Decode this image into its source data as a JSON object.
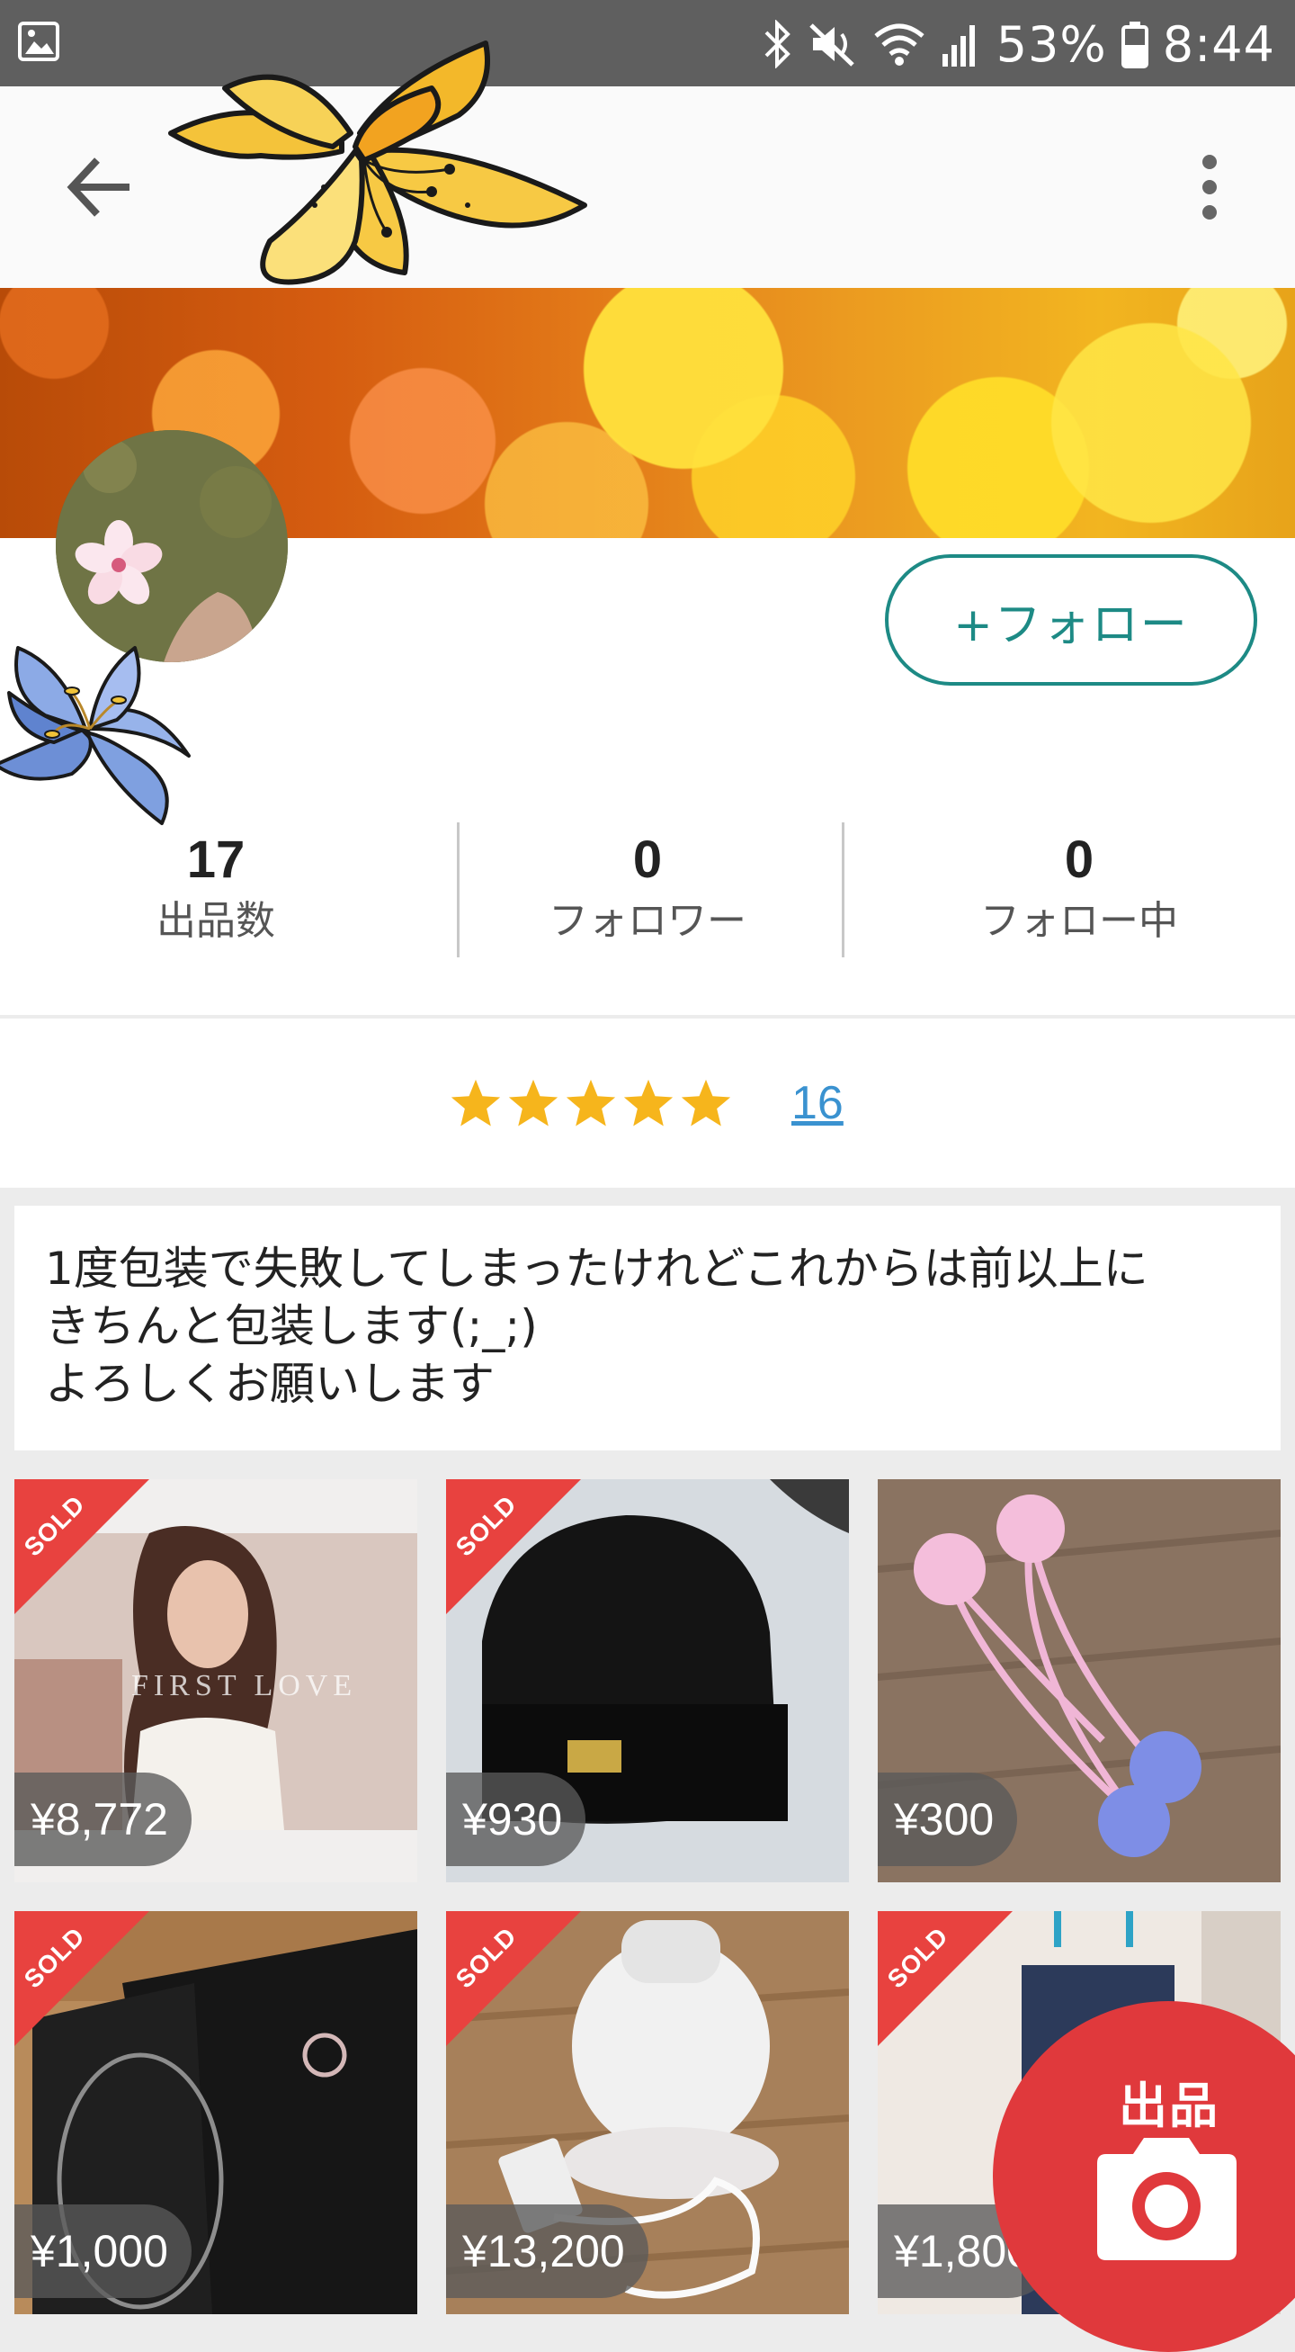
{
  "status_bar": {
    "battery": "53%",
    "time": "8:44"
  },
  "app_bar": {
    "back_icon": "arrow-left-icon",
    "menu_icon": "more-vertical-icon"
  },
  "profile": {
    "follow_label": "+フォロー",
    "stats": [
      {
        "value": "17",
        "label": "出品数"
      },
      {
        "value": "0",
        "label": "フォロワー"
      },
      {
        "value": "0",
        "label": "フォロー中"
      }
    ],
    "rating": {
      "stars": 5,
      "count": "16"
    },
    "bio": "1度包装で失敗してしまったけれどこれからは前以上に\nきちんと包装します(;_;)\nよろしくお願いします"
  },
  "items": [
    {
      "price": "¥8,772",
      "sold": true,
      "sold_label": "SOLD",
      "thumb_text": "FIRST LOVE"
    },
    {
      "price": "¥930",
      "sold": true,
      "sold_label": "SOLD"
    },
    {
      "price": "¥300",
      "sold": false
    },
    {
      "price": "¥1,000",
      "sold": true,
      "sold_label": "SOLD"
    },
    {
      "price": "¥13,200",
      "sold": true,
      "sold_label": "SOLD"
    },
    {
      "price": "¥1,800",
      "sold": true,
      "sold_label": "SOLD"
    }
  ],
  "fab": {
    "label": "出品",
    "icon": "camera-icon"
  },
  "colors": {
    "accent": "#1d8a85",
    "sold": "#e8423f",
    "fab": "#e0393c",
    "link": "#3a92d0",
    "star": "#f6b51c"
  }
}
